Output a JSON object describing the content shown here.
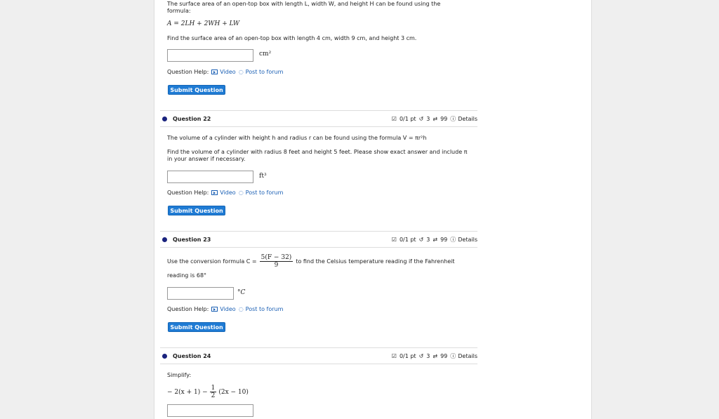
{
  "q21": {
    "intro_line1": "The surface area of an open-top box with length L, width W, and height H can be found using the",
    "intro_line2": "formula:",
    "formula": "A = 2LH + 2WH + LW",
    "prompt": "Find the surface area of an open-top box with length 4 cm, width 9 cm, and height 3 cm.",
    "input_value": "",
    "unit": "cm²",
    "help_label": "Question Help:",
    "video_label": "Video",
    "forum_label": "Post to forum",
    "submit_label": "Submit Question"
  },
  "q22": {
    "title": "Question 22",
    "score": "0/1 pt",
    "tries": "3",
    "retries": "99",
    "details": "Details",
    "line1": "The volume of a cylinder with height h and radius r can be found using the formula V = πr²h",
    "line2": "Find the volume of a cylinder with radius 8 feet and height 5 feet. Please show exact answer and include π",
    "line3": "in your answer if necessary.",
    "input_value": "",
    "unit": "ft³",
    "help_label": "Question Help:",
    "video_label": "Video",
    "forum_label": "Post to forum",
    "submit_label": "Submit Question"
  },
  "q23": {
    "title": "Question 23",
    "score": "0/1 pt",
    "tries": "3",
    "retries": "99",
    "details": "Details",
    "pre": "Use the conversion formula C =",
    "frac_num": "5(F − 32)",
    "frac_den": "9",
    "post": "to find the Celsius temperature reading if the Fahrenheit",
    "line2": "reading is 68°",
    "input_value": "",
    "unit": "°C",
    "help_label": "Question Help:",
    "video_label": "Video",
    "forum_label": "Post to forum",
    "submit_label": "Submit Question"
  },
  "q24": {
    "title": "Question 24",
    "score": "0/1 pt",
    "tries": "3",
    "retries": "99",
    "details": "Details",
    "label": "Simplify:",
    "expr_pre": "− 2(x + 1) −",
    "frac_num": "1",
    "frac_den": "2",
    "expr_post": "(2x − 10)",
    "input_value": ""
  }
}
